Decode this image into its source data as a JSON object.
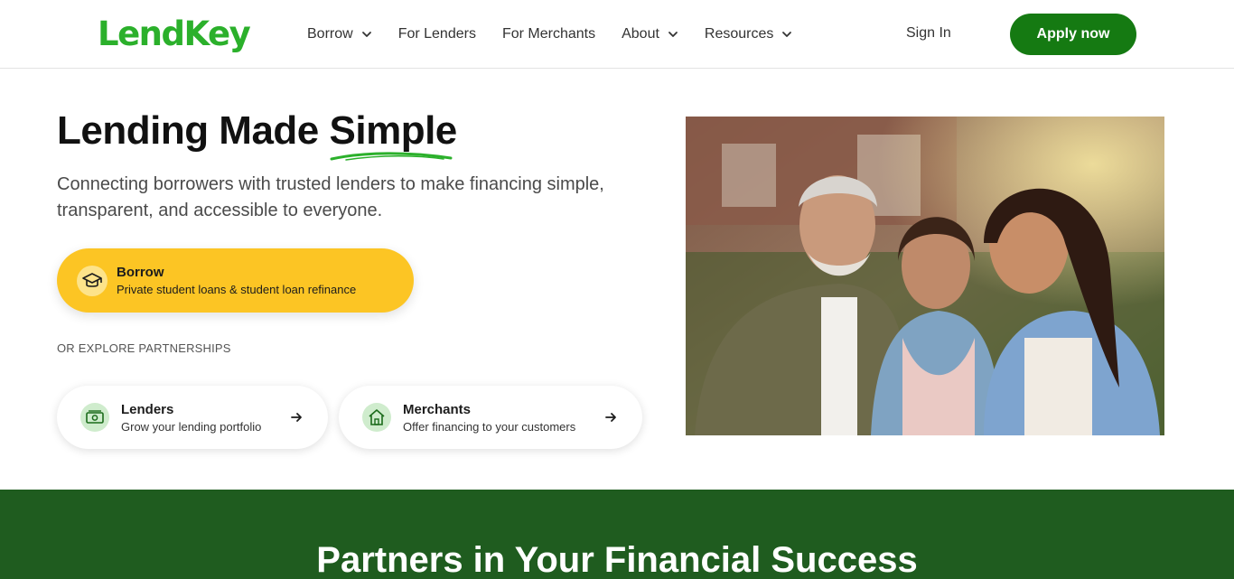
{
  "header": {
    "logo": "LendKey",
    "nav": [
      {
        "label": "Borrow",
        "has_dropdown": true
      },
      {
        "label": "For Lenders",
        "has_dropdown": false
      },
      {
        "label": "For Merchants",
        "has_dropdown": false
      },
      {
        "label": "About",
        "has_dropdown": true
      },
      {
        "label": "Resources",
        "has_dropdown": true
      }
    ],
    "sign_in": "Sign In",
    "apply_label": "Apply now"
  },
  "hero": {
    "title_prefix": "Lending Made ",
    "title_accent": "Simple",
    "subtitle": "Connecting borrowers with trusted lenders to make financing simple, transparent, and accessible to everyone.",
    "borrow_cta": {
      "icon": "graduation-cap-icon",
      "title": "Borrow",
      "subtitle": "Private student loans & student loan refinance"
    },
    "explore_label": "OR EXPLORE PARTNERSHIPS",
    "partners": [
      {
        "icon": "money-icon",
        "title": "Lenders",
        "subtitle": "Grow your lending portfolio"
      },
      {
        "icon": "house-icon",
        "title": "Merchants",
        "subtitle": "Offer financing to your customers"
      }
    ]
  },
  "band": {
    "title": "Partners in Your Financial Success"
  },
  "colors": {
    "brand_green": "#2bb02b",
    "apply_green": "#157a12",
    "cta_yellow": "#fcc524",
    "band_green": "#1f5c1f"
  }
}
